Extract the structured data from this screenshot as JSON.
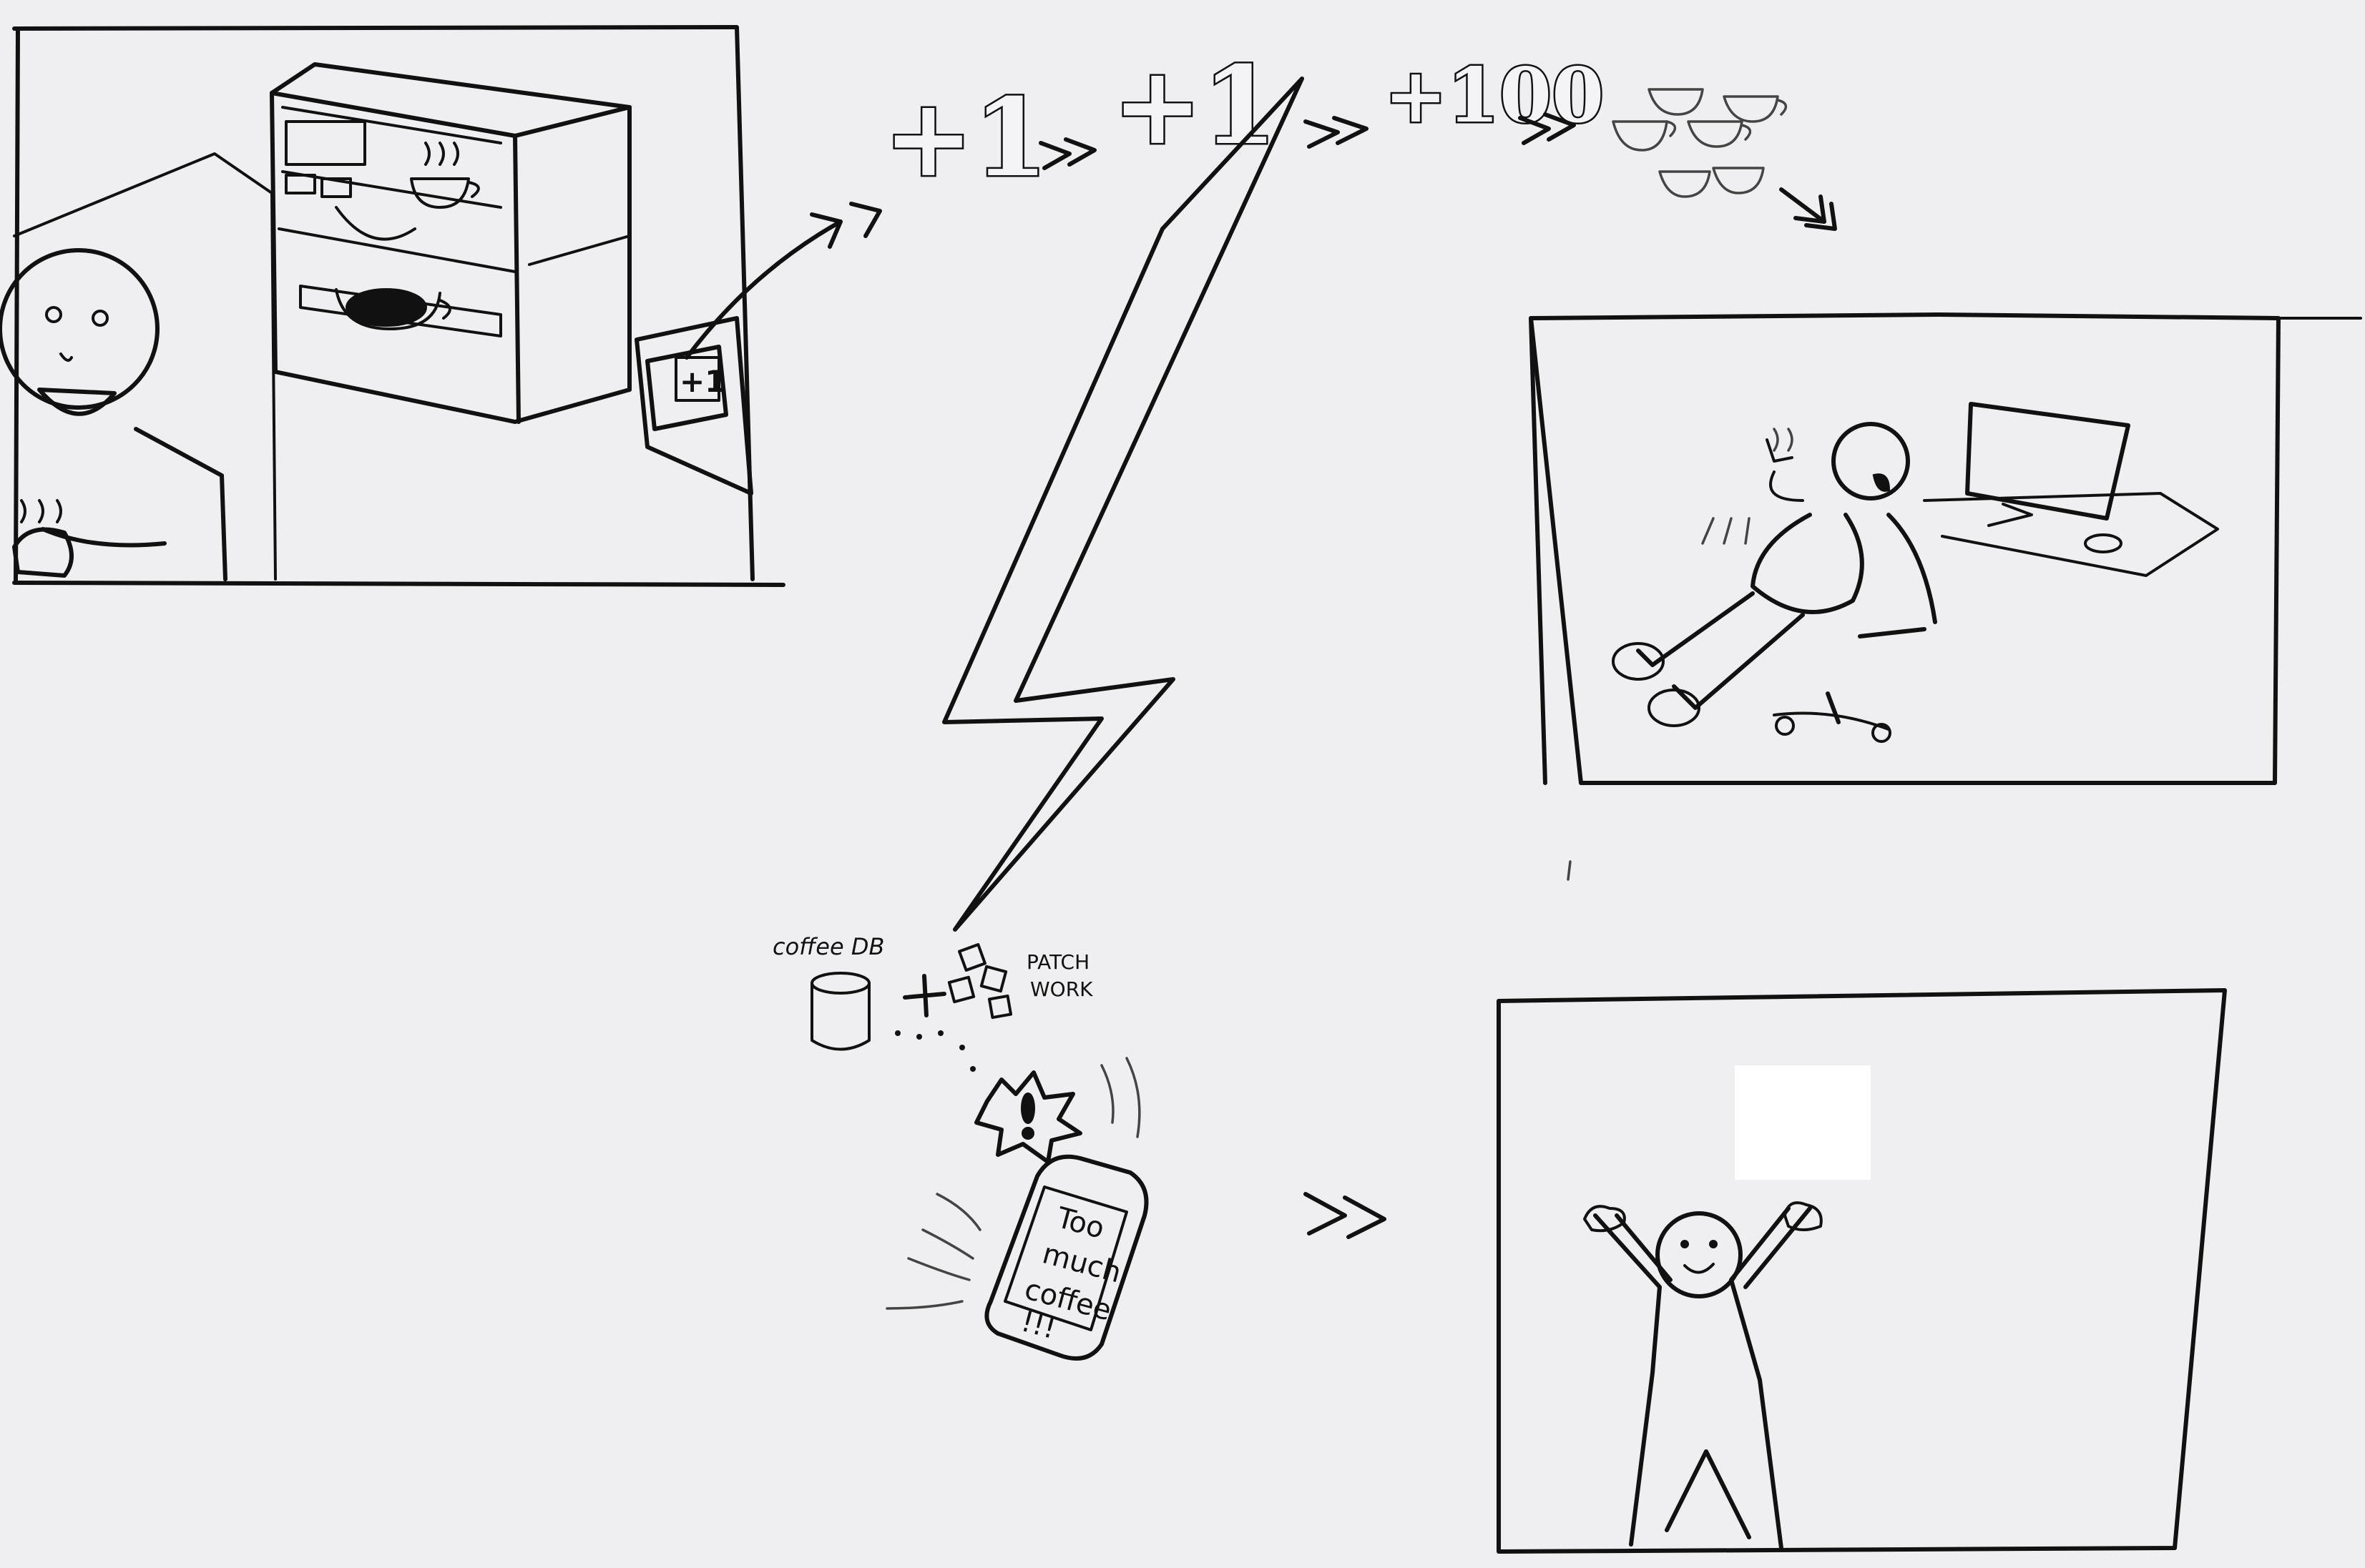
{
  "panel1": {
    "button_label": "+1"
  },
  "sequence": {
    "first": "+1",
    "second": "+1",
    "third": "+100"
  },
  "database": {
    "label": "coffee DB"
  },
  "patchwork": {
    "line1": "PATCH",
    "line2": "WORK"
  },
  "phone": {
    "line1": "Too",
    "line2": "much",
    "line3": "coffee",
    "line4": "!!!"
  }
}
